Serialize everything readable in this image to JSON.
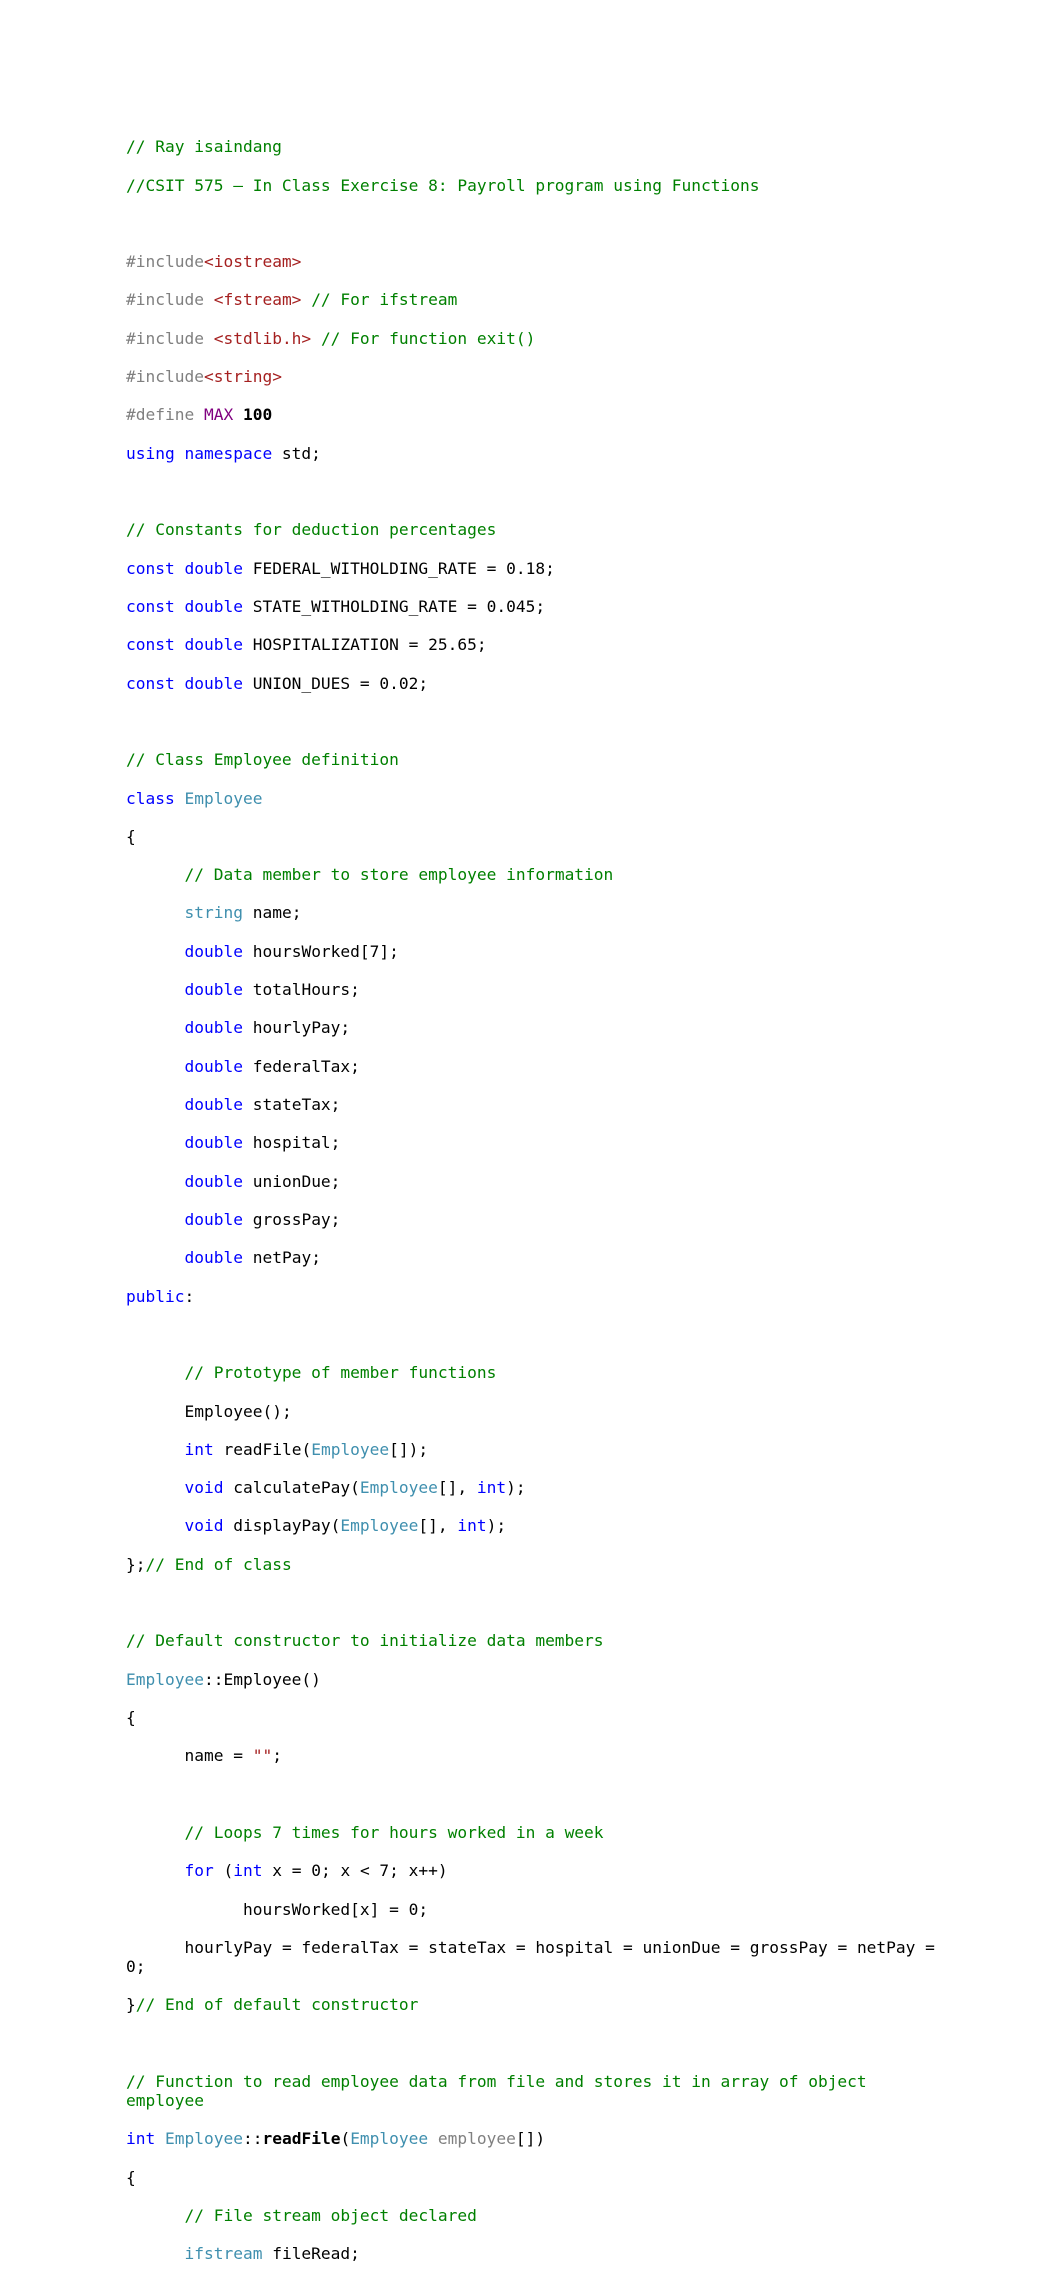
{
  "document": {
    "kind": "source-code-listing",
    "language": "C++",
    "page_background": "#ffffff",
    "text_color": "#000000"
  },
  "colors": {
    "comment": "#008000",
    "keyword": "#0000ff",
    "type": "#3f8fae",
    "preprocessor": "#808080",
    "header": "#a52020",
    "string": "#a52020",
    "macro": "#800080",
    "number": "#000000",
    "function": "#000000",
    "parameter": "#808080",
    "plain": "#000000"
  },
  "code": {
    "lines": [
      {
        "id": "l001",
        "tokens": [
          {
            "t": "// Ray isaindang",
            "c": "c"
          }
        ]
      },
      {
        "id": "l002",
        "tokens": [
          {
            "t": "//CSIT 575 – In Class Exercise 8: Payroll program using Functions",
            "c": "c"
          }
        ]
      },
      {
        "id": "l003",
        "tokens": []
      },
      {
        "id": "l004",
        "tokens": [
          {
            "t": "#include",
            "c": "pp"
          },
          {
            "t": "<iostream>",
            "c": "hdr"
          }
        ]
      },
      {
        "id": "l005",
        "tokens": [
          {
            "t": "#include ",
            "c": "pp"
          },
          {
            "t": "<fstream>",
            "c": "hdr"
          },
          {
            "t": " ",
            "c": "pl"
          },
          {
            "t": "// For ifstream",
            "c": "c"
          }
        ]
      },
      {
        "id": "l006",
        "tokens": [
          {
            "t": "#include ",
            "c": "pp"
          },
          {
            "t": "<stdlib.h>",
            "c": "hdr"
          },
          {
            "t": " ",
            "c": "pl"
          },
          {
            "t": "// For function exit()",
            "c": "c"
          }
        ]
      },
      {
        "id": "l007",
        "tokens": [
          {
            "t": "#include",
            "c": "pp"
          },
          {
            "t": "<string>",
            "c": "hdr"
          }
        ]
      },
      {
        "id": "l008",
        "tokens": [
          {
            "t": "#define ",
            "c": "pp"
          },
          {
            "t": "MAX",
            "c": "mac"
          },
          {
            "t": " ",
            "c": "pl"
          },
          {
            "t": "100",
            "c": "num"
          }
        ]
      },
      {
        "id": "l009",
        "tokens": [
          {
            "t": "using namespace",
            "c": "kw"
          },
          {
            "t": " std;",
            "c": "pl"
          }
        ]
      },
      {
        "id": "l010",
        "tokens": []
      },
      {
        "id": "l011",
        "tokens": [
          {
            "t": "// Constants for deduction percentages",
            "c": "c"
          }
        ]
      },
      {
        "id": "l012",
        "tokens": [
          {
            "t": "const double",
            "c": "kw"
          },
          {
            "t": " FEDERAL_WITHOLDING_RATE = 0.18;",
            "c": "pl"
          }
        ]
      },
      {
        "id": "l013",
        "tokens": [
          {
            "t": "const double",
            "c": "kw"
          },
          {
            "t": " STATE_WITHOLDING_RATE = 0.045;",
            "c": "pl"
          }
        ]
      },
      {
        "id": "l014",
        "tokens": [
          {
            "t": "const double",
            "c": "kw"
          },
          {
            "t": " HOSPITALIZATION = 25.65;",
            "c": "pl"
          }
        ]
      },
      {
        "id": "l015",
        "tokens": [
          {
            "t": "const double",
            "c": "kw"
          },
          {
            "t": " UNION_DUES = 0.02;",
            "c": "pl"
          }
        ]
      },
      {
        "id": "l016",
        "tokens": []
      },
      {
        "id": "l017",
        "tokens": [
          {
            "t": "// Class Employee definition",
            "c": "c"
          }
        ]
      },
      {
        "id": "l018",
        "tokens": [
          {
            "t": "class",
            "c": "kw"
          },
          {
            "t": " ",
            "c": "pl"
          },
          {
            "t": "Employee",
            "c": "ty"
          }
        ]
      },
      {
        "id": "l019",
        "tokens": [
          {
            "t": "{",
            "c": "pl"
          }
        ]
      },
      {
        "id": "l020",
        "tokens": [
          {
            "t": "      ",
            "c": "pl"
          },
          {
            "t": "// Data member to store employee information",
            "c": "c"
          }
        ]
      },
      {
        "id": "l021",
        "tokens": [
          {
            "t": "      ",
            "c": "pl"
          },
          {
            "t": "string",
            "c": "ty"
          },
          {
            "t": " name;",
            "c": "pl"
          }
        ]
      },
      {
        "id": "l022",
        "tokens": [
          {
            "t": "      ",
            "c": "pl"
          },
          {
            "t": "double",
            "c": "kw"
          },
          {
            "t": " hoursWorked[7];",
            "c": "pl"
          }
        ]
      },
      {
        "id": "l023",
        "tokens": [
          {
            "t": "      ",
            "c": "pl"
          },
          {
            "t": "double",
            "c": "kw"
          },
          {
            "t": " totalHours;",
            "c": "pl"
          }
        ]
      },
      {
        "id": "l024",
        "tokens": [
          {
            "t": "      ",
            "c": "pl"
          },
          {
            "t": "double",
            "c": "kw"
          },
          {
            "t": " hourlyPay;",
            "c": "pl"
          }
        ]
      },
      {
        "id": "l025",
        "tokens": [
          {
            "t": "      ",
            "c": "pl"
          },
          {
            "t": "double",
            "c": "kw"
          },
          {
            "t": " federalTax;",
            "c": "pl"
          }
        ]
      },
      {
        "id": "l026",
        "tokens": [
          {
            "t": "      ",
            "c": "pl"
          },
          {
            "t": "double",
            "c": "kw"
          },
          {
            "t": " stateTax;",
            "c": "pl"
          }
        ]
      },
      {
        "id": "l027",
        "tokens": [
          {
            "t": "      ",
            "c": "pl"
          },
          {
            "t": "double",
            "c": "kw"
          },
          {
            "t": " hospital;",
            "c": "pl"
          }
        ]
      },
      {
        "id": "l028",
        "tokens": [
          {
            "t": "      ",
            "c": "pl"
          },
          {
            "t": "double",
            "c": "kw"
          },
          {
            "t": " unionDue;",
            "c": "pl"
          }
        ]
      },
      {
        "id": "l029",
        "tokens": [
          {
            "t": "      ",
            "c": "pl"
          },
          {
            "t": "double",
            "c": "kw"
          },
          {
            "t": " grossPay;",
            "c": "pl"
          }
        ]
      },
      {
        "id": "l030",
        "tokens": [
          {
            "t": "      ",
            "c": "pl"
          },
          {
            "t": "double",
            "c": "kw"
          },
          {
            "t": " netPay;",
            "c": "pl"
          }
        ]
      },
      {
        "id": "l031",
        "tokens": [
          {
            "t": "public",
            "c": "kw"
          },
          {
            "t": ":",
            "c": "pl"
          }
        ]
      },
      {
        "id": "l032",
        "tokens": []
      },
      {
        "id": "l033",
        "tokens": [
          {
            "t": "      ",
            "c": "pl"
          },
          {
            "t": "// Prototype of member functions",
            "c": "c"
          }
        ]
      },
      {
        "id": "l034",
        "tokens": [
          {
            "t": "      Employee();",
            "c": "pl"
          }
        ]
      },
      {
        "id": "l035",
        "tokens": [
          {
            "t": "      ",
            "c": "pl"
          },
          {
            "t": "int",
            "c": "kw"
          },
          {
            "t": " readFile(",
            "c": "pl"
          },
          {
            "t": "Employee",
            "c": "ty"
          },
          {
            "t": "[]);",
            "c": "pl"
          }
        ]
      },
      {
        "id": "l036",
        "tokens": [
          {
            "t": "      ",
            "c": "pl"
          },
          {
            "t": "void",
            "c": "kw"
          },
          {
            "t": " calculatePay(",
            "c": "pl"
          },
          {
            "t": "Employee",
            "c": "ty"
          },
          {
            "t": "[], ",
            "c": "pl"
          },
          {
            "t": "int",
            "c": "kw"
          },
          {
            "t": ");",
            "c": "pl"
          }
        ]
      },
      {
        "id": "l037",
        "tokens": [
          {
            "t": "      ",
            "c": "pl"
          },
          {
            "t": "void",
            "c": "kw"
          },
          {
            "t": " displayPay(",
            "c": "pl"
          },
          {
            "t": "Employee",
            "c": "ty"
          },
          {
            "t": "[], ",
            "c": "pl"
          },
          {
            "t": "int",
            "c": "kw"
          },
          {
            "t": ");",
            "c": "pl"
          }
        ]
      },
      {
        "id": "l038",
        "tokens": [
          {
            "t": "};",
            "c": "pl"
          },
          {
            "t": "// End of class",
            "c": "c"
          }
        ]
      },
      {
        "id": "l039",
        "tokens": []
      },
      {
        "id": "l040",
        "tokens": [
          {
            "t": "// Default constructor to initialize data members",
            "c": "c"
          }
        ]
      },
      {
        "id": "l041",
        "tokens": [
          {
            "t": "Employee",
            "c": "ty"
          },
          {
            "t": "::Employee()",
            "c": "pl"
          }
        ]
      },
      {
        "id": "l042",
        "tokens": [
          {
            "t": "{",
            "c": "pl"
          }
        ]
      },
      {
        "id": "l043",
        "tokens": [
          {
            "t": "      name = ",
            "c": "pl"
          },
          {
            "t": "\"\"",
            "c": "str"
          },
          {
            "t": ";",
            "c": "pl"
          }
        ]
      },
      {
        "id": "l044",
        "tokens": []
      },
      {
        "id": "l045",
        "tokens": [
          {
            "t": "      ",
            "c": "pl"
          },
          {
            "t": "// Loops 7 times for hours worked in a week",
            "c": "c"
          }
        ]
      },
      {
        "id": "l046",
        "tokens": [
          {
            "t": "      ",
            "c": "pl"
          },
          {
            "t": "for",
            "c": "kw"
          },
          {
            "t": " (",
            "c": "pl"
          },
          {
            "t": "int",
            "c": "kw"
          },
          {
            "t": " x = 0; x < 7; x++)",
            "c": "pl"
          }
        ]
      },
      {
        "id": "l047",
        "tokens": [
          {
            "t": "            hoursWorked[x] = 0;",
            "c": "pl"
          }
        ]
      },
      {
        "id": "l048",
        "tokens": [
          {
            "t": "      hourlyPay = federalTax = stateTax = hospital = unionDue = grossPay = netPay = 0;",
            "c": "pl"
          }
        ]
      },
      {
        "id": "l049",
        "tokens": [
          {
            "t": "}",
            "c": "pl"
          },
          {
            "t": "// End of default constructor",
            "c": "c"
          }
        ]
      },
      {
        "id": "l050",
        "tokens": []
      },
      {
        "id": "l051",
        "tokens": [
          {
            "t": "// Function to read employee data from file and stores it in array of object employee",
            "c": "c"
          }
        ]
      },
      {
        "id": "l052",
        "tokens": [
          {
            "t": "int",
            "c": "kw"
          },
          {
            "t": " ",
            "c": "pl"
          },
          {
            "t": "Employee",
            "c": "ty"
          },
          {
            "t": "::",
            "c": "pl"
          },
          {
            "t": "readFile",
            "c": "fn"
          },
          {
            "t": "(",
            "c": "pl"
          },
          {
            "t": "Employee",
            "c": "ty"
          },
          {
            "t": " ",
            "c": "pl"
          },
          {
            "t": "employee",
            "c": "par"
          },
          {
            "t": "[])",
            "c": "pl"
          }
        ]
      },
      {
        "id": "l053",
        "tokens": [
          {
            "t": "{",
            "c": "pl"
          }
        ]
      },
      {
        "id": "l054",
        "tokens": [
          {
            "t": "      ",
            "c": "pl"
          },
          {
            "t": "// File stream object declared",
            "c": "c"
          }
        ]
      },
      {
        "id": "l055",
        "tokens": [
          {
            "t": "      ",
            "c": "pl"
          },
          {
            "t": "ifstream",
            "c": "ty"
          },
          {
            "t": " fileRead;",
            "c": "pl"
          }
        ]
      }
    ]
  }
}
